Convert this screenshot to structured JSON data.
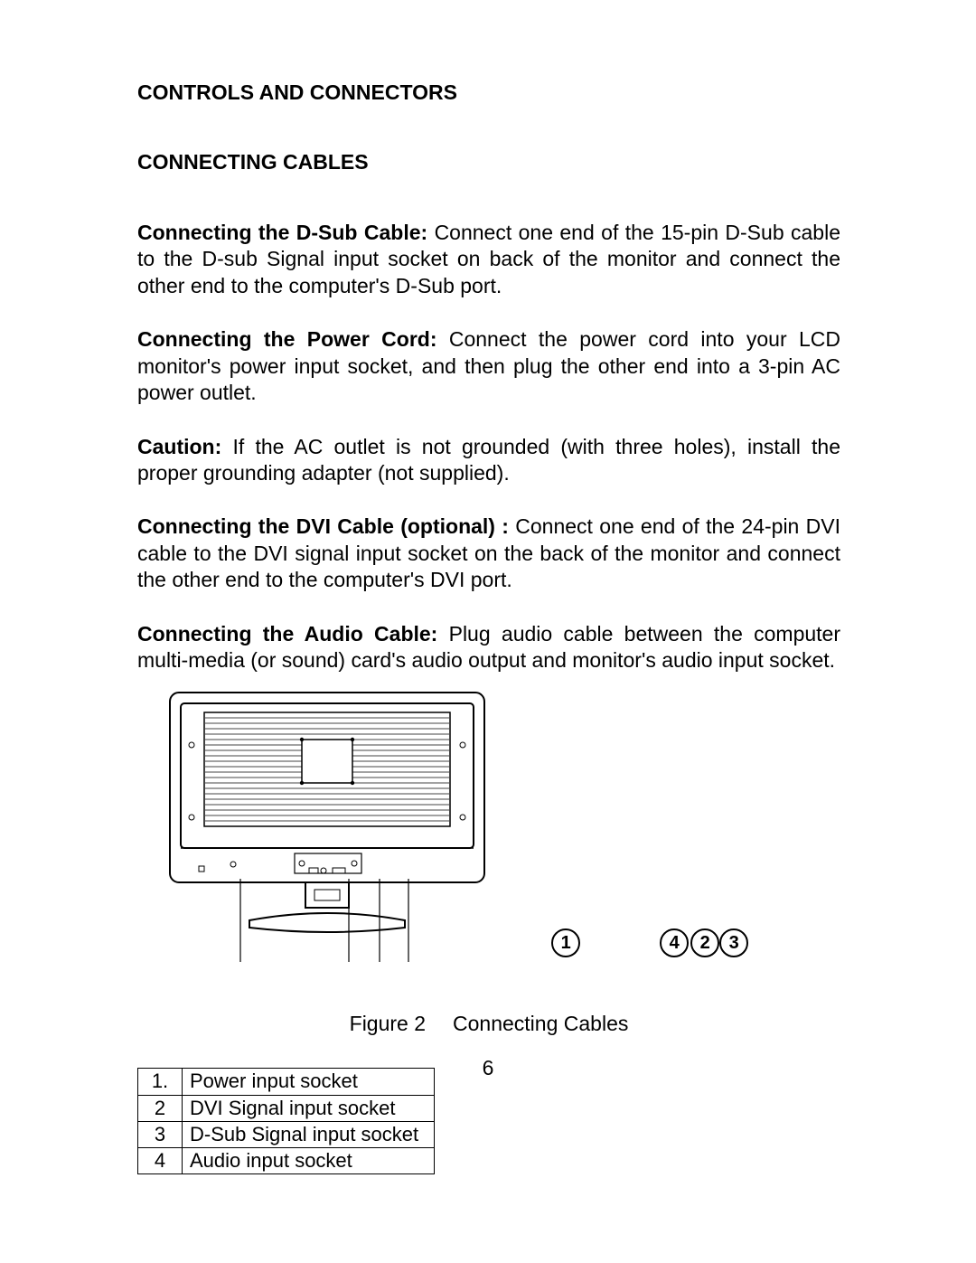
{
  "title": "CONTROLS AND CONNECTORS",
  "subtitle": "CONNECTING CABLES",
  "paragraphs": {
    "p1": {
      "lead": "Connecting the D-Sub Cable: ",
      "body": "Connect one end of the 15-pin D-Sub cable to the D-sub Signal input socket on back of the monitor and connect the other end to the computer's D-Sub port."
    },
    "p2": {
      "lead": "Connecting the Power Cord: ",
      "body": "Connect the power cord into your LCD monitor's power input socket, and then plug the other end into a 3-pin AC power outlet."
    },
    "p3": {
      "lead": "Caution: ",
      "body": "If the AC outlet is not grounded (with three holes), install the proper grounding adapter (not supplied)."
    },
    "p4": {
      "lead": "Connecting the DVI Cable (optional) :  ",
      "body": "Connect one end of the 24-pin DVI cable to the      DVI signal input socket on the back   of  the monitor and  connect the other end to the computer's DVI port."
    },
    "p5": {
      "lead": "Connecting the Audio Cable: ",
      "body": "Plug audio cable between the computer multi-media (or sound) card's audio output  and monitor's audio input socket."
    }
  },
  "figure": {
    "caption_label": "Figure 2",
    "caption_text": "Connecting  Cables",
    "callouts": [
      "1",
      "4",
      "2",
      "3"
    ]
  },
  "legend": [
    {
      "n": "1.",
      "t": "Power  input socket"
    },
    {
      "n": "2",
      "t": "DVI  Signal input socket"
    },
    {
      "n": "3",
      "t": "D-Sub Signal input socket"
    },
    {
      "n": "4",
      "t": "Audio input socket"
    }
  ],
  "page_number": "6"
}
